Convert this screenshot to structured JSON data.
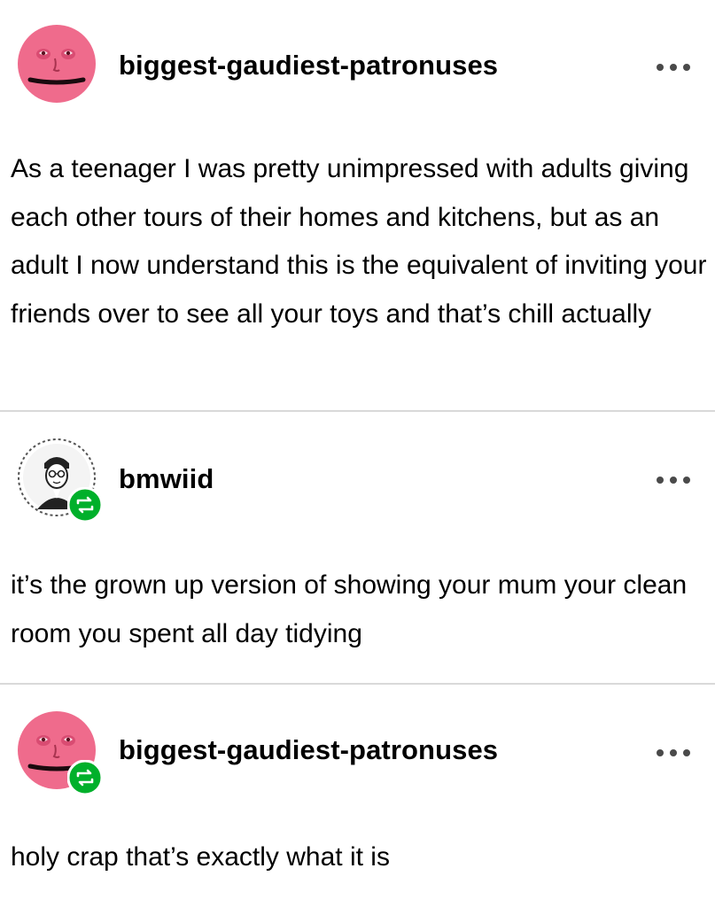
{
  "posts": [
    {
      "username": "biggest-gaudiest-patronuses",
      "avatar_icon": "pink-moon-face-avatar",
      "reblogged": false,
      "more_icon": "ellipsis-icon",
      "body": "As a teenager I was pretty unimpressed with adults giving each other tours of their homes and kitchens, but as an adult I now understand this is the equivalent of inviting your friends over to see all your toys and that’s chill actually"
    },
    {
      "username": "bmwiid",
      "avatar_icon": "sketch-portrait-avatar",
      "reblogged": true,
      "reblog_icon": "reblog-icon",
      "more_icon": "ellipsis-icon",
      "body": "it’s the grown up version of showing your mum your clean room you spent all day tidying"
    },
    {
      "username": "biggest-gaudiest-patronuses",
      "avatar_icon": "pink-moon-face-avatar",
      "reblogged": true,
      "reblog_icon": "reblog-icon",
      "more_icon": "ellipsis-icon",
      "body": "holy crap that’s exactly what it is"
    }
  ],
  "colors": {
    "avatar_pink": "#ef6b8c",
    "reblog_green": "#00b02b",
    "divider": "#d9d9d9",
    "more_dots": "#4a4a4a"
  }
}
